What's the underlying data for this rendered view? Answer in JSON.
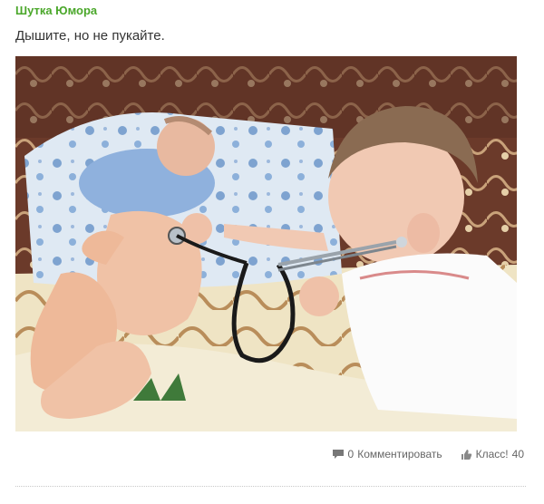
{
  "post": {
    "group_name": "Шутка Юмора",
    "text": "Дышите, но не пукайте."
  },
  "actions": {
    "comment_icon": "speech-bubble-icon",
    "comment_count": "0",
    "comment_label": "Комментировать",
    "like_icon": "thumbs-up-icon",
    "like_label": "Класс!",
    "like_count": "40"
  },
  "colors": {
    "group_name": "#4aa72a",
    "action_text": "#666666"
  }
}
